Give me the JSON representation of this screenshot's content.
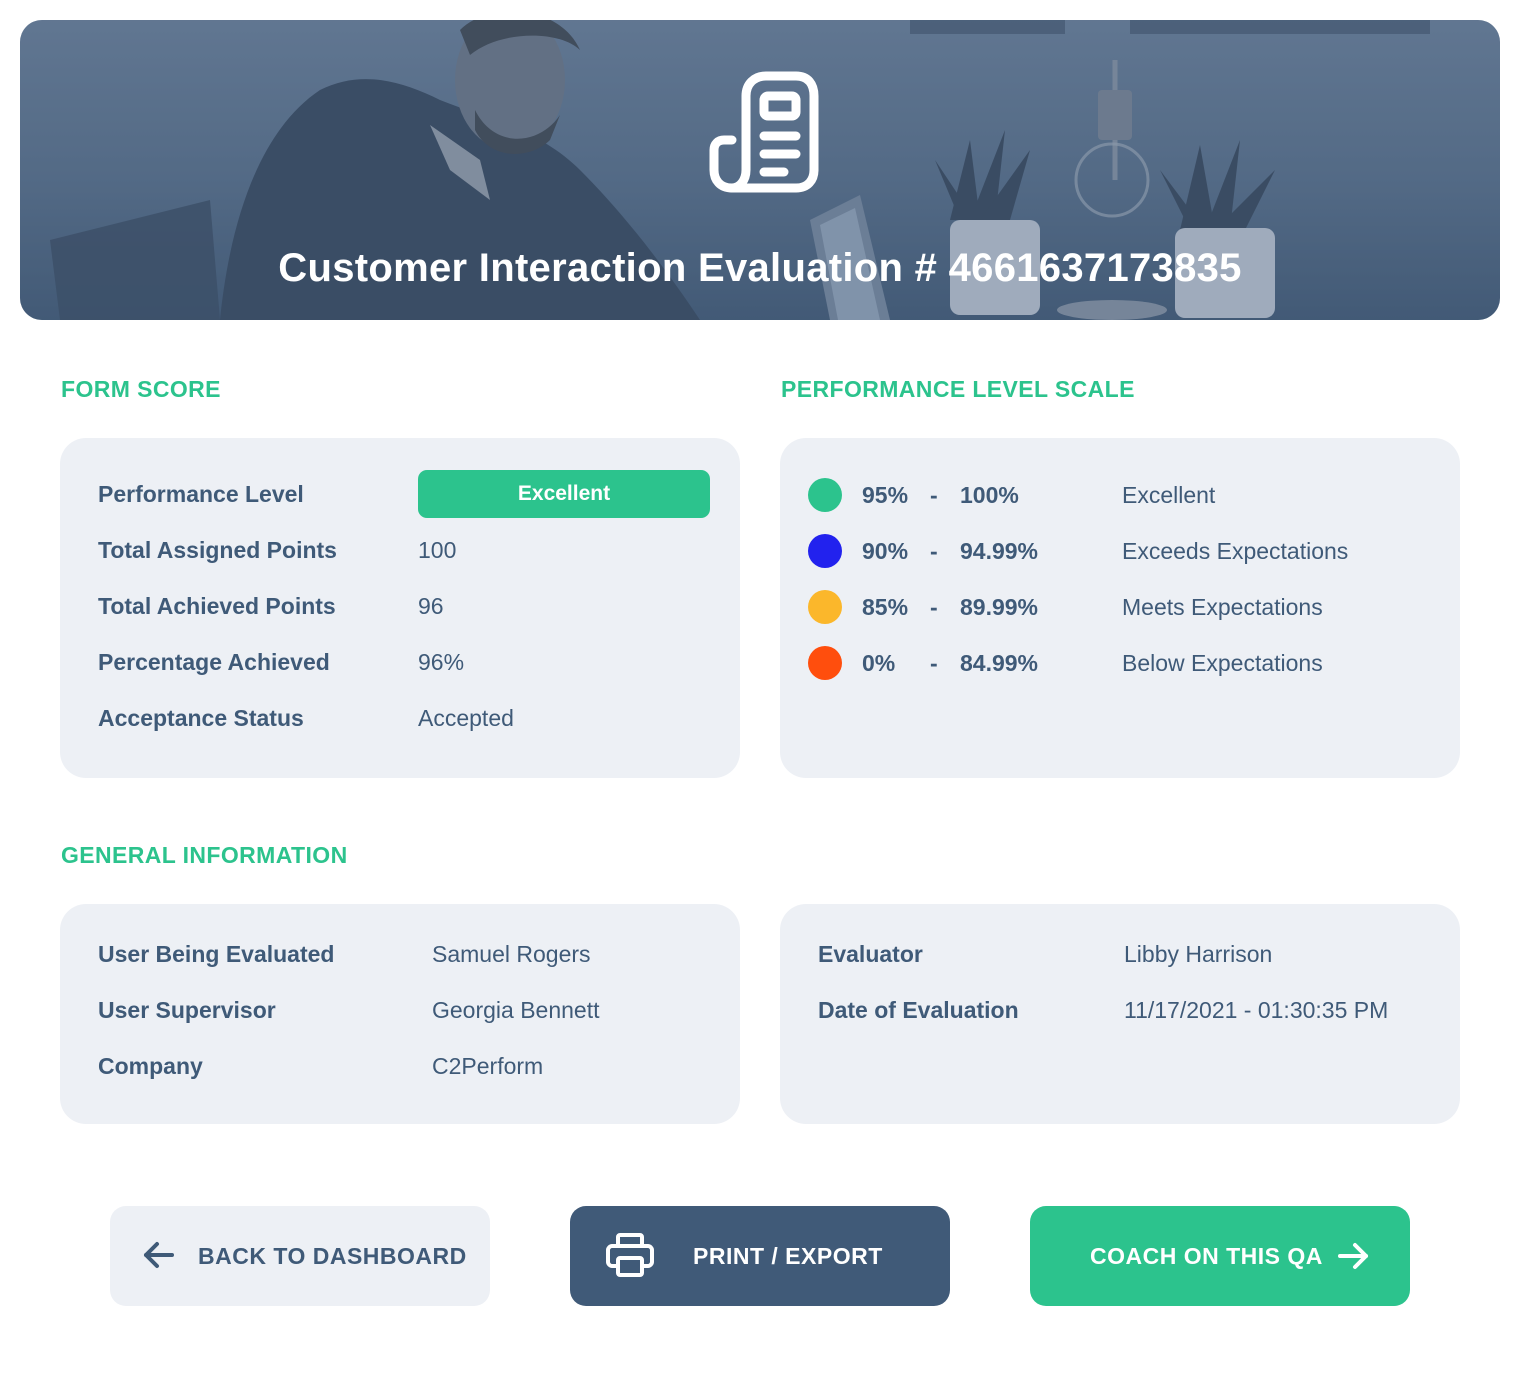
{
  "header": {
    "title": "Customer Interaction Evaluation # 4661637173835",
    "icon": "document-icon"
  },
  "form_score": {
    "section_title": "FORM SCORE",
    "performance_level_label": "Performance Level",
    "performance_level_value": "Excellent",
    "rows": [
      {
        "label": "Total Assigned Points",
        "value": "100"
      },
      {
        "label": "Total Achieved Points",
        "value": "96"
      },
      {
        "label": "Percentage Achieved",
        "value": "96%"
      },
      {
        "label": "Acceptance Status",
        "value": "Accepted"
      }
    ]
  },
  "performance_scale": {
    "section_title": "PERFORMANCE LEVEL SCALE",
    "levels": [
      {
        "low": "95%",
        "sep": "-",
        "high": "100%",
        "name": "Excellent",
        "color": "#2cc38d"
      },
      {
        "low": "90%",
        "sep": "-",
        "high": "94.99%",
        "name": "Exceeds Expectations",
        "color": "#2222ee"
      },
      {
        "low": "85%",
        "sep": "-",
        "high": "89.99%",
        "name": "Meets Expectations",
        "color": "#fbb72b"
      },
      {
        "low": "0%",
        "sep": "-",
        "high": "84.99%",
        "name": "Below Expectations",
        "color": "#ff4e0d"
      }
    ]
  },
  "general_info": {
    "section_title": "GENERAL INFORMATION",
    "left": [
      {
        "label": "User Being Evaluated",
        "value": "Samuel Rogers"
      },
      {
        "label": "User Supervisor",
        "value": "Georgia Bennett"
      },
      {
        "label": "Company",
        "value": "C2Perform"
      }
    ],
    "right": [
      {
        "label": "Evaluator",
        "value": "Libby Harrison"
      },
      {
        "label": "Date of Evaluation",
        "value": "11/17/2021 - 01:30:35 PM"
      }
    ]
  },
  "actions": {
    "back_label": "BACK TO DASHBOARD",
    "print_label": "PRINT / EXPORT",
    "coach_label": "COACH ON THIS QA"
  },
  "colors": {
    "accent": "#2cc38d",
    "navy": "#405a78",
    "card_bg": "#edf0f5"
  }
}
